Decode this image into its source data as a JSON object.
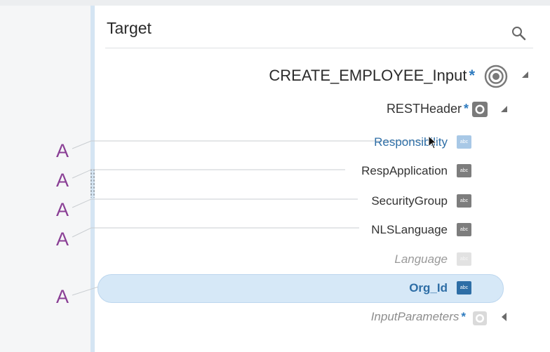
{
  "panel": {
    "title": "Target",
    "search_icon": "search-icon"
  },
  "tree": {
    "root": {
      "label": "CREATE_EMPLOYEE_Input",
      "required": "*",
      "icon": "target-icon"
    },
    "header": {
      "label": "RESTHeader",
      "required": "*",
      "icon": "element-icon"
    },
    "fields": [
      {
        "label": "Responsibility",
        "chip": "abc",
        "state": "hover",
        "mapped": true
      },
      {
        "label": "RespApplication",
        "chip": "abc",
        "state": "normal",
        "mapped": true
      },
      {
        "label": "SecurityGroup",
        "chip": "abc",
        "state": "normal",
        "mapped": true
      },
      {
        "label": "NLSLanguage",
        "chip": "abc",
        "state": "normal",
        "mapped": true
      },
      {
        "label": "Language",
        "chip": "abc",
        "state": "optional",
        "mapped": false
      },
      {
        "label": "Org_Id",
        "chip": "abc",
        "state": "selected",
        "mapped": true
      }
    ],
    "input_params": {
      "label": "InputParameters",
      "required": "*",
      "icon": "element-icon"
    }
  },
  "mapping_markers": [
    "A",
    "A",
    "A",
    "A",
    "A"
  ],
  "colors": {
    "accent": "#2e7bbf",
    "selected_bg": "#d6e8f7",
    "marker": "#8a3f95"
  }
}
